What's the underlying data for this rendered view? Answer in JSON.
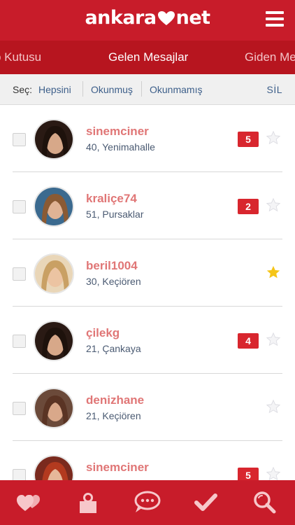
{
  "header": {
    "logo_left": "ankara",
    "logo_right": "net",
    "menu_icon": "hamburger-menu-icon"
  },
  "tabs": [
    {
      "label": "Gelen Kutusu",
      "visible_label": "p Kutusu",
      "active": false
    },
    {
      "label": "Gelen Mesajlar",
      "active": true
    },
    {
      "label": "Giden Me",
      "active": false
    }
  ],
  "filter": {
    "label": "Seç:",
    "all": "Hepsini",
    "read": "Okunmuş",
    "unread": "Okunmamış",
    "delete": "SİL"
  },
  "colors": {
    "brand_red": "#c81c2a",
    "tab_bar": "#b7151f",
    "name_color": "#e07676",
    "badge_red": "#d8262e",
    "star_active": "#f5c518",
    "star_inactive": "#e8e8ec"
  },
  "messages": [
    {
      "username": "sinemciner",
      "age_location": "40, Yenimahalle",
      "unread_count": "5",
      "starred": false,
      "avatar": "woman-dark-hair"
    },
    {
      "username": "kraliçe74",
      "age_location": "51, Pursaklar",
      "unread_count": "2",
      "starred": false,
      "avatar": "woman-long-brown-hair"
    },
    {
      "username": "beril1004",
      "age_location": "30, Keçiören",
      "unread_count": "",
      "starred": true,
      "avatar": "woman-blonde-hair"
    },
    {
      "username": "çilekg",
      "age_location": "21, Çankaya",
      "unread_count": "4",
      "starred": false,
      "avatar": "woman-dark-hair"
    },
    {
      "username": "denizhane",
      "age_location": "21, Keçiören",
      "unread_count": "",
      "starred": false,
      "avatar": "woman-brown-hair"
    },
    {
      "username": "sinemciner",
      "age_location": "",
      "unread_count": "5",
      "starred": false,
      "avatar": "woman-red-hair"
    }
  ],
  "bottom_nav": [
    {
      "icon": "hearts-icon"
    },
    {
      "icon": "profile-photo-icon"
    },
    {
      "icon": "chat-bubbles-icon"
    },
    {
      "icon": "checkmark-icon"
    },
    {
      "icon": "search-icon"
    }
  ]
}
